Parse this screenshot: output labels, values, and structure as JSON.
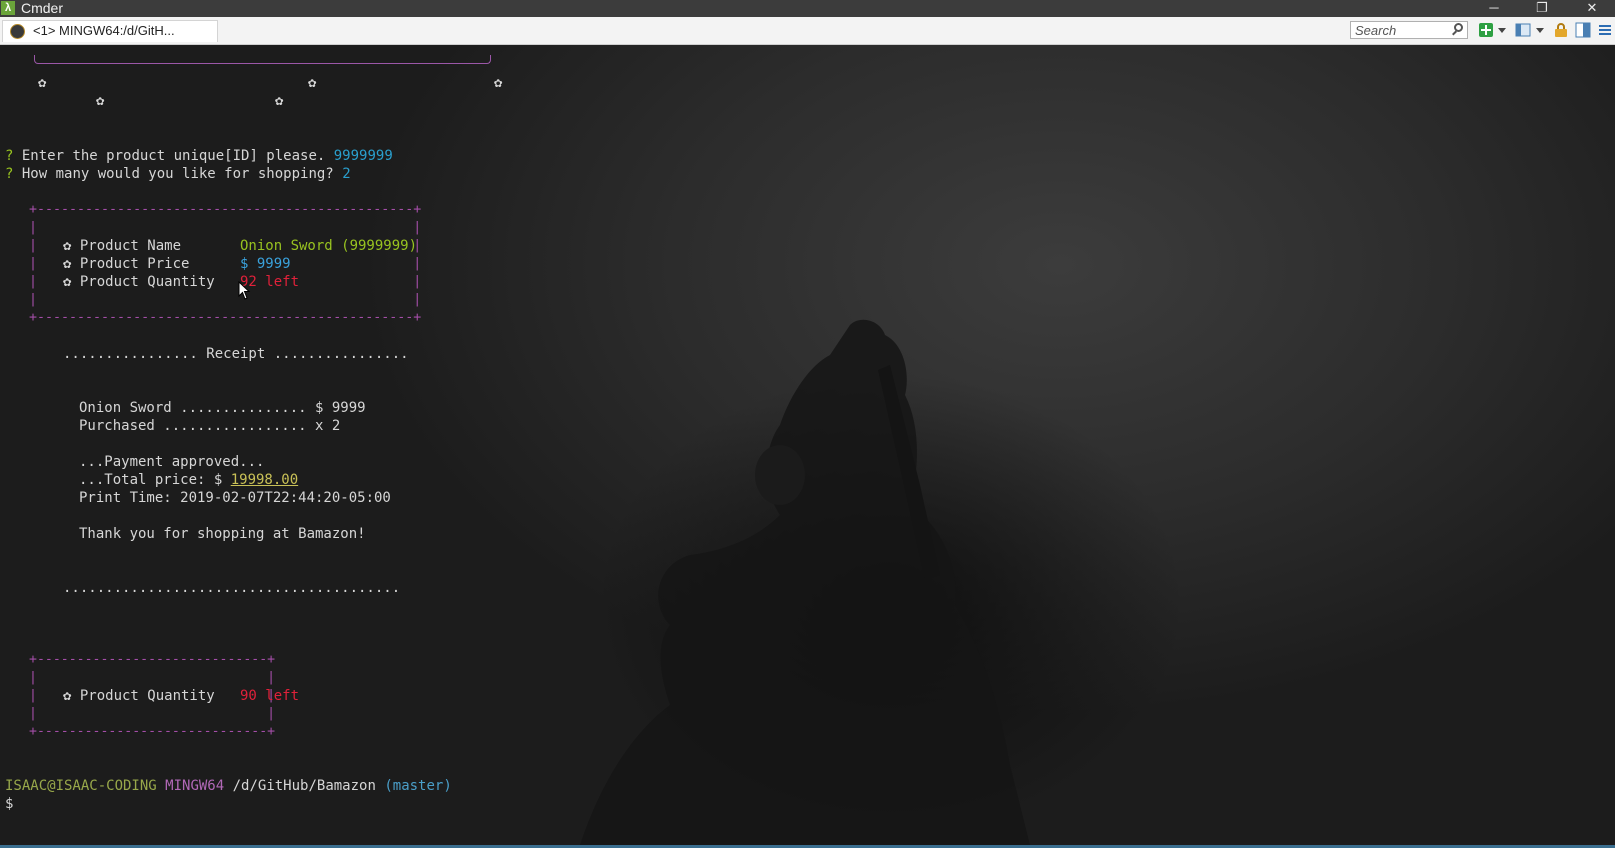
{
  "window": {
    "title": "Cmder",
    "app_icon_glyph": "λ",
    "minimize_glyph": "─",
    "restore_glyph": "❐",
    "close_glyph": "✕"
  },
  "toolbar": {
    "tab_label": "<1> MINGW64:/d/GitH...",
    "search_placeholder": "Search"
  },
  "terminal": {
    "stars_top": "✿",
    "prompt_marker": "?",
    "q1_text": "Enter the product unique[ID] please.",
    "q1_answer": "9999999",
    "q2_text": "How many would you like for shopping?",
    "q2_answer": "2",
    "box1_top": "+-----------------------------------------------+",
    "box1_side": "|                                               |",
    "box1_bottom": "+-----------------------------------------------+",
    "rows": [
      {
        "label": "✿ Product Name",
        "value": "Onion Sword (9999999)"
      },
      {
        "label": "✿ Product Price",
        "value": "$ 9999"
      },
      {
        "label": "✿ Product Quantity",
        "value": "92 left"
      }
    ],
    "receipt_header": "................ Receipt ................",
    "item_line": "Onion Sword ............... $ 9999",
    "purchased_line": "Purchased ................. x 2",
    "payment_line": "...Payment approved...",
    "total_prefix": "...Total price: $ ",
    "total_value": "19998.00",
    "print_time": "Print Time: 2019-02-07T22:44:20-05:00",
    "thanks": "Thank you for shopping at Bamazon!",
    "receipt_footer": "........................................",
    "box2_top": "+-----------------------------+",
    "box2_side": "|                             |",
    "box2_bottom": "+-----------------------------+",
    "box2_label": "✿ Product Quantity",
    "box2_value": "90 left",
    "prompt_user": "ISAAC@ISAAC-CODING",
    "prompt_env": "MINGW64",
    "prompt_path": "/d/GitHub/Bamazon",
    "prompt_branch": "(master)",
    "prompt_symbol": "$"
  },
  "colors": {
    "prompt_green": "#98c320",
    "answer_cyan": "#2a9fcd",
    "quantity_red": "#e0213a",
    "box_purple": "#a44ea8",
    "total_ochre": "#c9c157"
  },
  "icons": [
    "app-icon",
    "tab-icon",
    "search-icon",
    "new-console-icon",
    "dropdown-icon",
    "layout-icon",
    "lock-icon",
    "panes-icon",
    "menu-icon",
    "mouse-cursor-icon",
    "star-icon"
  ]
}
